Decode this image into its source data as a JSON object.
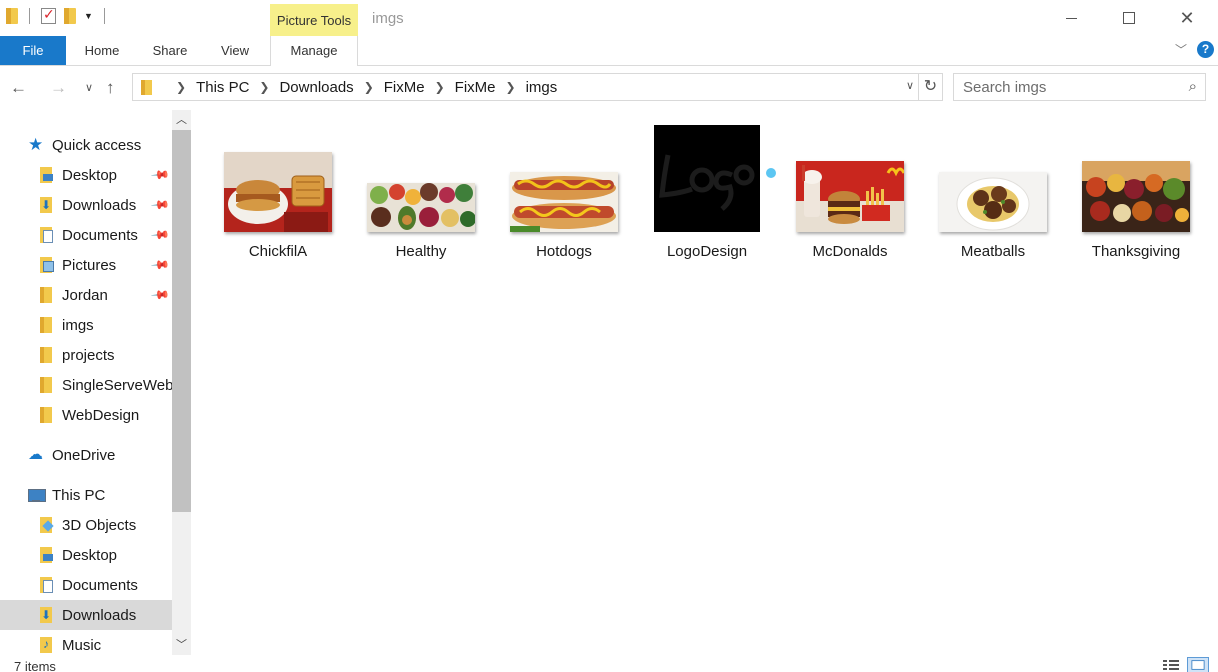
{
  "window": {
    "title": "imgs",
    "context_tab_group": "Picture Tools"
  },
  "ribbon": {
    "tabs": [
      "File",
      "Home",
      "Share",
      "View",
      "Manage"
    ],
    "help_label": "?"
  },
  "address_bar": {
    "crumbs": [
      "This PC",
      "Downloads",
      "FixMe",
      "FixMe",
      "imgs"
    ]
  },
  "search": {
    "placeholder": "Search imgs"
  },
  "nav_pane": {
    "quick_access_label": "Quick access",
    "quick_access_items": [
      {
        "label": "Desktop",
        "icon": "desktop-folder-icon",
        "pinned": true
      },
      {
        "label": "Downloads",
        "icon": "downloads-folder-icon",
        "pinned": true
      },
      {
        "label": "Documents",
        "icon": "documents-folder-icon",
        "pinned": true
      },
      {
        "label": "Pictures",
        "icon": "pictures-folder-icon",
        "pinned": true
      },
      {
        "label": "Jordan",
        "icon": "folder-icon",
        "pinned": true
      },
      {
        "label": "imgs",
        "icon": "folder-icon",
        "pinned": false
      },
      {
        "label": "projects",
        "icon": "folder-icon",
        "pinned": false
      },
      {
        "label": "SingleServeWebs",
        "icon": "folder-icon",
        "pinned": false
      },
      {
        "label": "WebDesign",
        "icon": "folder-icon",
        "pinned": false
      }
    ],
    "onedrive_label": "OneDrive",
    "this_pc_label": "This PC",
    "this_pc_items": [
      {
        "label": "3D Objects",
        "icon": "3d-objects-folder-icon"
      },
      {
        "label": "Desktop",
        "icon": "desktop-folder-icon"
      },
      {
        "label": "Documents",
        "icon": "documents-folder-icon"
      },
      {
        "label": "Downloads",
        "icon": "downloads-folder-icon",
        "selected": true
      },
      {
        "label": "Music",
        "icon": "music-folder-icon"
      }
    ]
  },
  "files": [
    {
      "name": "ChickfilA",
      "thumbnail": "chicken-sandwich-waffle-fries-photo"
    },
    {
      "name": "Healthy",
      "thumbnail": "healthy-food-bowls-photo"
    },
    {
      "name": "Hotdogs",
      "thumbnail": "hotdog-mustard-photo"
    },
    {
      "name": "LogoDesign",
      "thumbnail": "black-logo-script-image"
    },
    {
      "name": "McDonalds",
      "thumbnail": "burger-fries-shake-photo"
    },
    {
      "name": "Meatballs",
      "thumbnail": "meatballs-plate-photo"
    },
    {
      "name": "Thanksgiving",
      "thumbnail": "harvest-food-spread-photo"
    }
  ],
  "status": {
    "item_count": "7 items"
  },
  "colors": {
    "accent": "#1979ca",
    "picture_tools_highlight": "#f7f08b",
    "selection": "#d9d9d9"
  }
}
